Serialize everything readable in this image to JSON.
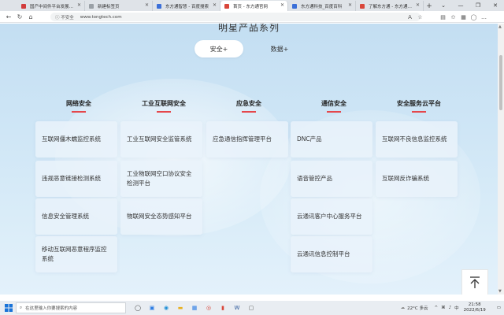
{
  "browser": {
    "tabs": [
      {
        "title": "国产中间件平台发展研究的...",
        "active": false,
        "fav_color": "#d23c3c"
      },
      {
        "title": "新建标签页",
        "active": false,
        "fav_color": "#9aa0a6"
      },
      {
        "title": "东方通智慧 - 百度搜索",
        "active": false,
        "fav_color": "#3b6fd8"
      },
      {
        "title": "首页 - 东方通官网",
        "active": true,
        "fav_color": "#d9463a"
      },
      {
        "title": "东方通科技_百度百科",
        "active": false,
        "fav_color": "#3b6fd8"
      },
      {
        "title": "了解东方通 - 东方通官网",
        "active": false,
        "fav_color": "#d9463a"
      }
    ],
    "new_tab": "+",
    "security_label": "不安全",
    "url": "www.tongtech.com"
  },
  "page": {
    "section_title": "明星产品系列",
    "tab_security": "安全+",
    "tab_data": "数据+",
    "columns": [
      {
        "title": "网络安全",
        "items": [
          "互联网僵木蠕监控系统",
          "违规恶意链接检测系统",
          "信息安全管理系统",
          "移动互联网恶意程序监控系统"
        ]
      },
      {
        "title": "工业互联网安全",
        "items": [
          "工业互联网安全监管系统",
          "工业物联网空口协议安全检测平台",
          "物联网安全态势感知平台"
        ]
      },
      {
        "title": "应急安全",
        "items": [
          "应急通信指挥管理平台"
        ]
      },
      {
        "title": "通信安全",
        "items": [
          "DNC产品",
          "语音管控产品",
          "云通讯客户中心服务平台",
          "云通讯信息控制平台"
        ]
      },
      {
        "title": "安全服务云平台",
        "items": [
          "互联网不良信息监控系统",
          "互联网反诈骗系统"
        ]
      }
    ],
    "accent_color": "#e5474b"
  },
  "taskbar": {
    "search_placeholder": "在这里输入你要搜索的内容",
    "weather": "22°C 多云",
    "time": "21:58",
    "date": "2022/6/19"
  }
}
